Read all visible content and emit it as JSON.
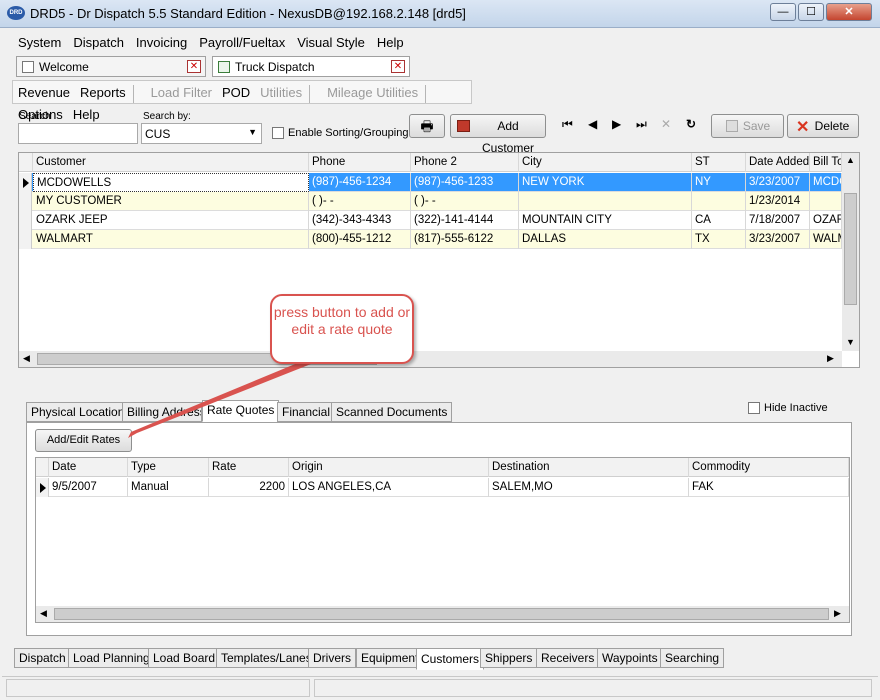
{
  "window": {
    "title": "DRD5 - Dr Dispatch 5.5 Standard Edition - NexusDB@192.168.2.148 [drd5]",
    "app_icon": "DRD",
    "min": "—",
    "max": "☐",
    "close": "✕"
  },
  "menu": [
    "System",
    "Dispatch",
    "Invoicing",
    "Payroll/Fueltax",
    "Visual Style",
    "Help"
  ],
  "doc_tabs": [
    {
      "label": "Welcome"
    },
    {
      "label": "Truck Dispatch"
    }
  ],
  "sub_menu": [
    {
      "label": "Revenue",
      "enabled": true
    },
    {
      "label": "Reports",
      "enabled": true
    },
    {
      "label": "Load Filter",
      "enabled": false
    },
    {
      "label": "POD",
      "enabled": true
    },
    {
      "label": "Utilities",
      "enabled": false
    },
    {
      "label": "Mileage Utilities",
      "enabled": false
    },
    {
      "label": "Options",
      "enabled": true
    },
    {
      "label": "Help",
      "enabled": true
    }
  ],
  "toolbar": {
    "search_label": "Search",
    "search_value": "",
    "searchby_label": "Search by:",
    "searchby_value": "CUS",
    "sorting_label": "Enable Sorting/Grouping",
    "add_customer": "Add Customer",
    "save": "Save",
    "delete": "Delete"
  },
  "customers": {
    "columns": [
      "Customer",
      "Phone",
      "Phone 2",
      "City",
      "ST",
      "Date Added",
      "Bill To"
    ],
    "rows": [
      [
        "MCDOWELLS",
        "(987)-456-1234",
        "(987)-456-1233",
        "NEW YORK",
        "NY",
        "3/23/2007",
        "MCDO"
      ],
      [
        "MY CUSTOMER",
        "(   )-   -",
        "(   )-   -",
        "",
        "",
        "1/23/2014",
        ""
      ],
      [
        "OZARK  JEEP",
        "(342)-343-4343",
        "(322)-141-4144",
        "MOUNTAIN CITY",
        "CA",
        "7/18/2007",
        "OZAR"
      ],
      [
        "WALMART",
        "(800)-455-1212",
        "(817)-555-6122",
        "DALLAS",
        "TX",
        "3/23/2007",
        "WALM"
      ]
    ]
  },
  "callout": {
    "text": "press button to add or edit a rate quote",
    "color": "#d9534f"
  },
  "detail_tabs": [
    "Physical Location",
    "Billing Address",
    "Rate Quotes",
    "Financial",
    "Scanned Documents"
  ],
  "hide_inactive": "Hide Inactive",
  "add_edit_rates": "Add/Edit Rates",
  "rates": {
    "columns": [
      "Date",
      "Type",
      "Rate",
      "Origin",
      "Destination",
      "Commodity"
    ],
    "rows": [
      [
        "9/5/2007",
        "Manual",
        "2200",
        "LOS ANGELES,CA",
        "SALEM,MO",
        "FAK"
      ]
    ]
  },
  "bottom_tabs": [
    "Dispatch",
    "Load Planning",
    "Load Board",
    "Templates/Lanes",
    "Drivers",
    "Equipment",
    "Customers",
    "Shippers",
    "Receivers",
    "Waypoints",
    "Searching"
  ],
  "active_bottom_tab": "Customers",
  "colors": {
    "selection": "#3399ff",
    "alt_row": "#fdfde0",
    "accent": "#d9534f"
  }
}
